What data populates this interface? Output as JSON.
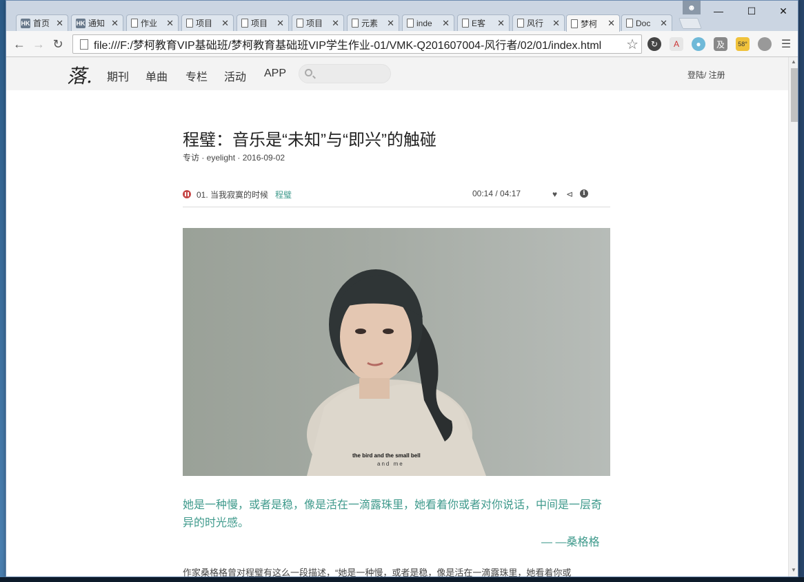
{
  "browser": {
    "tabs": [
      {
        "label": "首页",
        "icon": "hk-icon"
      },
      {
        "label": "通知",
        "icon": "hk-icon"
      },
      {
        "label": "作业",
        "icon": "page-icon"
      },
      {
        "label": "项目",
        "icon": "page-icon"
      },
      {
        "label": "项目",
        "icon": "page-icon"
      },
      {
        "label": "项目",
        "icon": "page-icon"
      },
      {
        "label": "元素",
        "icon": "page-icon"
      },
      {
        "label": "inde",
        "icon": "page-icon"
      },
      {
        "label": "E客",
        "icon": "page-icon"
      },
      {
        "label": "风行",
        "icon": "page-icon"
      },
      {
        "label": "梦柯",
        "icon": "page-icon",
        "active": true
      },
      {
        "label": "Doc",
        "icon": "page-icon"
      }
    ],
    "close_glyph": "✕",
    "url": "file:///F:/梦柯教育VIP基础班/梦柯教育基础班VIP学生作业-01/VMK-Q201607004-风行者/02/01/index.html",
    "weather_badge": "58°"
  },
  "site": {
    "logo": "落.",
    "nav": [
      "期刊",
      "单曲",
      "专栏",
      "活动",
      "APP"
    ],
    "search_placeholder": "",
    "login": "登陆/ 注册"
  },
  "article": {
    "title": "程璧：音乐是“未知”与“即兴”的触碰",
    "meta": "专访 · eyelight · 2016-09-02",
    "player": {
      "track": "01. 当我寂寞的时候",
      "artist": "程璧",
      "time": "00:14 / 04:17"
    },
    "photo_caption": "the bird and the small bell",
    "photo_caption2": "and me",
    "quote": "她是一种慢，或者是稳，像是活在一滴露珠里，她看着你或者对你说话，中间是一层奇异的时光感。",
    "quote_source": "— —桑格格",
    "body": "作家桑格格曾对程璧有这么一段描述，“她是一种慢，或者是稳，像是活在一滴露珠里，她看着你或"
  },
  "colors": {
    "accent": "#3f9a8c",
    "pause": "#c64747"
  }
}
